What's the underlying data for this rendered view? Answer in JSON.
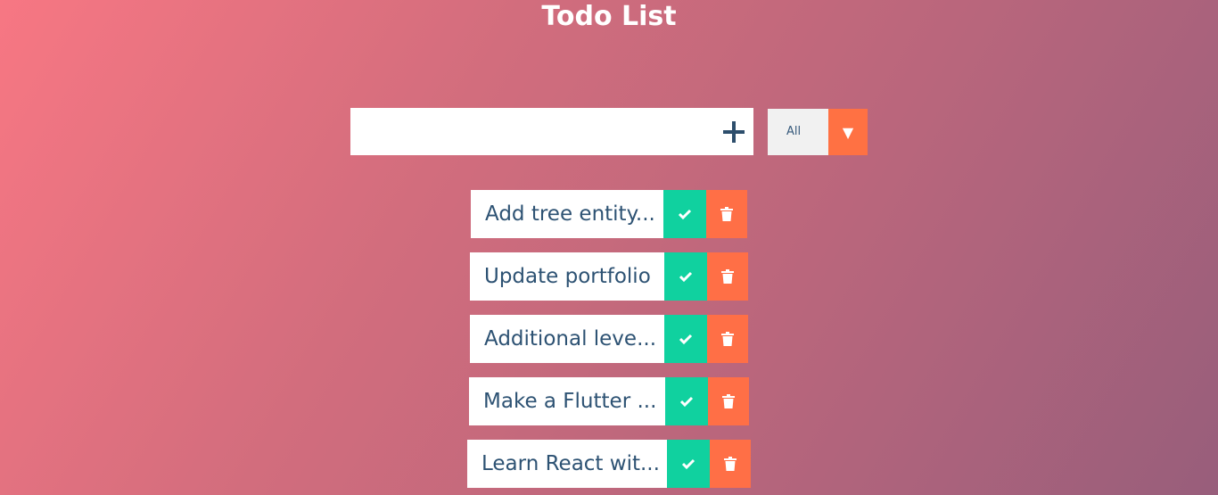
{
  "app": {
    "title": "Todo List"
  },
  "add_form": {
    "input_value": "",
    "button_icon": "plus-icon"
  },
  "filter": {
    "selected": "All",
    "arrow_icon": "caret-down-icon",
    "arrow_glyph": "▼"
  },
  "todos": [
    {
      "text": "Add tree entity...",
      "complete_icon": "check-icon",
      "delete_icon": "trash-icon"
    },
    {
      "text": "Update portfolio",
      "complete_icon": "check-icon",
      "delete_icon": "trash-icon"
    },
    {
      "text": "Additional leve...",
      "complete_icon": "check-icon",
      "delete_icon": "trash-icon"
    },
    {
      "text": "Make a Flutter ...",
      "complete_icon": "check-icon",
      "delete_icon": "trash-icon"
    },
    {
      "text": "Learn React wit...",
      "complete_icon": "check-icon",
      "delete_icon": "trash-icon"
    }
  ],
  "colors": {
    "background_start": "#f77783",
    "background_end": "#985e7b",
    "complete": "#10d19f",
    "delete": "#ff6f46",
    "text": "#2d5273"
  }
}
